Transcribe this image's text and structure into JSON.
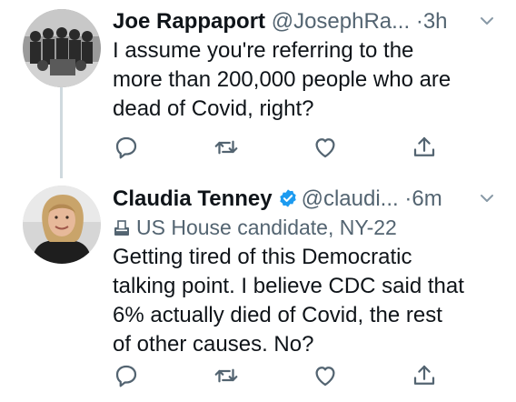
{
  "tweets": [
    {
      "author_name": "Joe Rappaport",
      "handle": "@JosephRa...",
      "separator": "·",
      "time": "3h",
      "text": "I assume you're referring to the\nmore than 200,000 people who are\ndead of Covid, right?",
      "avatar": "group-photo-avatar"
    },
    {
      "author_name": "Claudia Tenney",
      "verified": true,
      "handle": "@claudi...",
      "separator": "·",
      "time": "6m",
      "label": "US House candidate, NY-22",
      "label_icon": "ballot-box-icon",
      "text": "Getting tired of this Democratic\ntalking point. I believe CDC said that\n6% actually died of Covid, the rest\nof other causes. No?",
      "avatar": "portrait-avatar"
    }
  ],
  "actions": [
    "reply-icon",
    "retweet-icon",
    "like-icon",
    "share-icon"
  ],
  "colors": {
    "text": "#0f1419",
    "secondary": "#536471",
    "verified": "#1d9bf0",
    "icon": "#536471",
    "thread_line": "#cfd9de"
  }
}
